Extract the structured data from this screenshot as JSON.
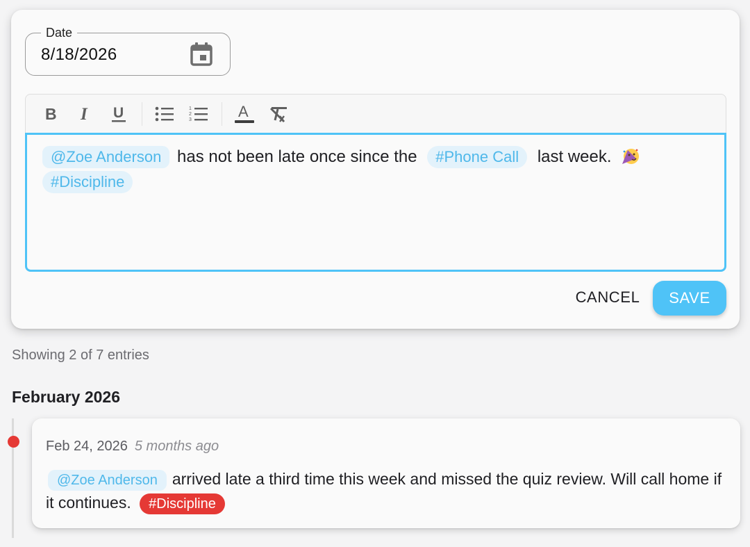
{
  "editor": {
    "date_label": "Date",
    "date_value": "8/18/2026",
    "toolbar": {
      "bold": "B",
      "italic": "I",
      "underline": "U",
      "bulleted_list": "bulleted-list-icon",
      "numbered_list": "numbered-list-icon",
      "text_color": "A",
      "clear_format": "clear-format-icon"
    },
    "content": {
      "mention": "@Zoe Anderson",
      "text_1": "has not been late once since the",
      "tag_1": "#Phone Call",
      "text_2": "last week.",
      "emoji": "partying-face-icon",
      "tag_2": "#Discipline"
    },
    "cancel_label": "CANCEL",
    "save_label": "SAVE"
  },
  "list": {
    "count_text": "Showing 2 of 7 entries",
    "month_heading": "February 2026"
  },
  "entries": [
    {
      "date": "Feb 24, 2026",
      "relative": "5 months ago",
      "mention": "@Zoe Anderson",
      "text": "arrived late a third time this week and missed the quiz review. Will call home if it continues.",
      "tag": "#Discipline",
      "dot_color": "#e53935"
    }
  ],
  "colors": {
    "accent": "#4fc3f7",
    "chip_bg": "#e3f2fb",
    "chip_text": "#4fb8ea",
    "discipline_tag": "#e53935"
  }
}
